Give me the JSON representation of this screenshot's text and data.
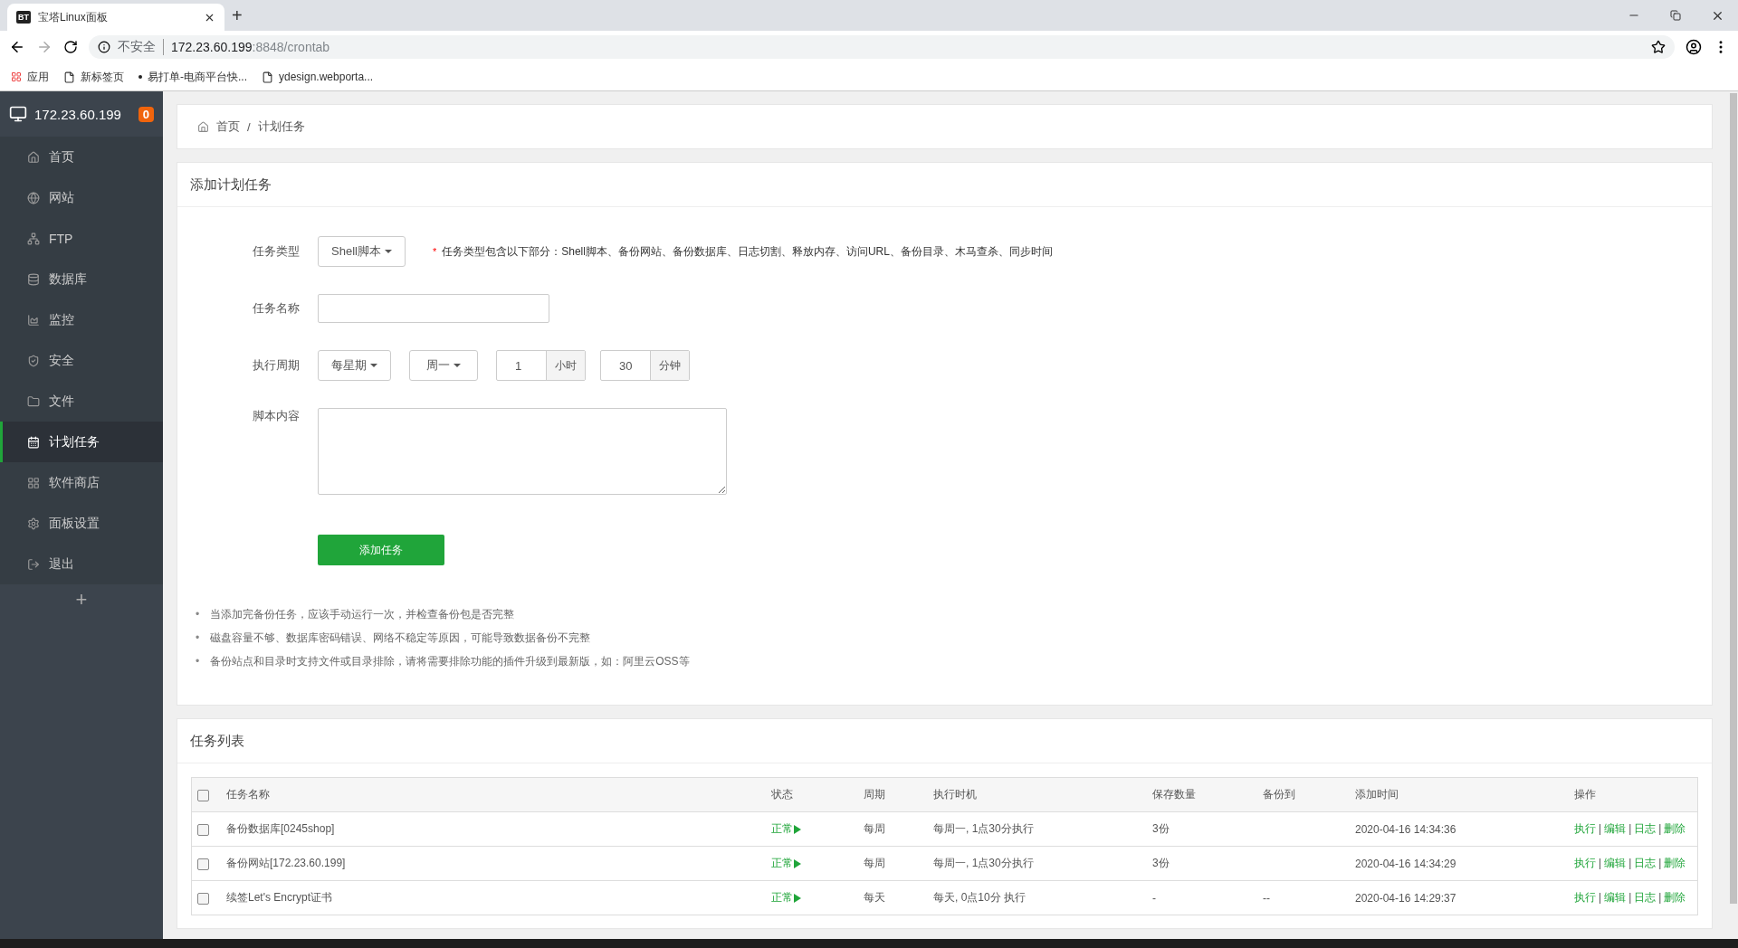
{
  "browser": {
    "tab_title": "宝塔Linux面板",
    "tab_logo": "BT",
    "new_tab": "+",
    "security": "不安全",
    "url_host": "172.23.60.199",
    "url_rest": ":8848/crontab",
    "bookmarks": [
      "应用",
      "新标签页",
      "易打单-电商平台快...",
      "ydesign.webporta..."
    ]
  },
  "sidebar": {
    "host": "172.23.60.199",
    "badge": "0",
    "add": "+",
    "items": [
      {
        "label": "首页",
        "selected": false
      },
      {
        "label": "网站",
        "selected": false
      },
      {
        "label": "FTP",
        "selected": false
      },
      {
        "label": "数据库",
        "selected": false
      },
      {
        "label": "监控",
        "selected": false
      },
      {
        "label": "安全",
        "selected": false
      },
      {
        "label": "文件",
        "selected": false
      },
      {
        "label": "计划任务",
        "selected": true
      },
      {
        "label": "软件商店",
        "selected": false
      },
      {
        "label": "面板设置",
        "selected": false
      },
      {
        "label": "退出",
        "selected": false
      }
    ]
  },
  "breadcrumb": {
    "items": [
      "首页",
      "计划任务"
    ],
    "separator": "/"
  },
  "add_form": {
    "title": "添加计划任务",
    "type_label": "任务类型",
    "type_value": "Shell脚本",
    "required_mark": "*",
    "type_note": "任务类型包含以下部分：Shell脚本、备份网站、备份数据库、日志切割、释放内存、访问URL、备份目录、木马查杀、同步时间",
    "name_label": "任务名称",
    "period_label": "执行周期",
    "period_select": "每星期",
    "weekday_select": "周一",
    "hour_value": "1",
    "hour_unit": "小时",
    "minute_value": "30",
    "minute_unit": "分钟",
    "script_label": "脚本内容",
    "submit": "添加任务",
    "tip_bullet": "•",
    "tips": [
      "当添加完备份任务，应该手动运行一次，并检查备份包是否完整",
      "磁盘容量不够、数据库密码错误、网络不稳定等原因，可能导致数据备份不完整",
      "备份站点和目录时支持文件或目录排除，请将需要排除功能的插件升级到最新版，如：阿里云OSS等"
    ]
  },
  "task_list": {
    "title": "任务列表",
    "select_all": false,
    "columns": [
      "任务名称",
      "状态",
      "周期",
      "执行时机",
      "保存数量",
      "备份到",
      "添加时间",
      "操作"
    ],
    "action_separator": "|",
    "rows": [
      {
        "checked": false,
        "name": "备份数据库[0245shop]",
        "status": "正常",
        "period": "每周",
        "timing": "每周一, 1点30分执行",
        "keep": "3份",
        "backup_to": "",
        "added": "2020-04-16 14:34:36",
        "actions": [
          "执行",
          "编辑",
          "日志",
          "删除"
        ]
      },
      {
        "checked": false,
        "name": "备份网站[172.23.60.199]",
        "status": "正常",
        "period": "每周",
        "timing": "每周一, 1点30分执行",
        "keep": "3份",
        "backup_to": "",
        "added": "2020-04-16 14:34:29",
        "actions": [
          "执行",
          "编辑",
          "日志",
          "删除"
        ]
      },
      {
        "checked": false,
        "name": "续签Let's Encrypt证书",
        "status": "正常",
        "period": "每天",
        "timing": "每天, 0点10分 执行",
        "keep": "-",
        "backup_to": "--",
        "added": "2020-04-16 14:29:37",
        "actions": [
          "执行",
          "编辑",
          "日志",
          "删除"
        ]
      }
    ]
  }
}
